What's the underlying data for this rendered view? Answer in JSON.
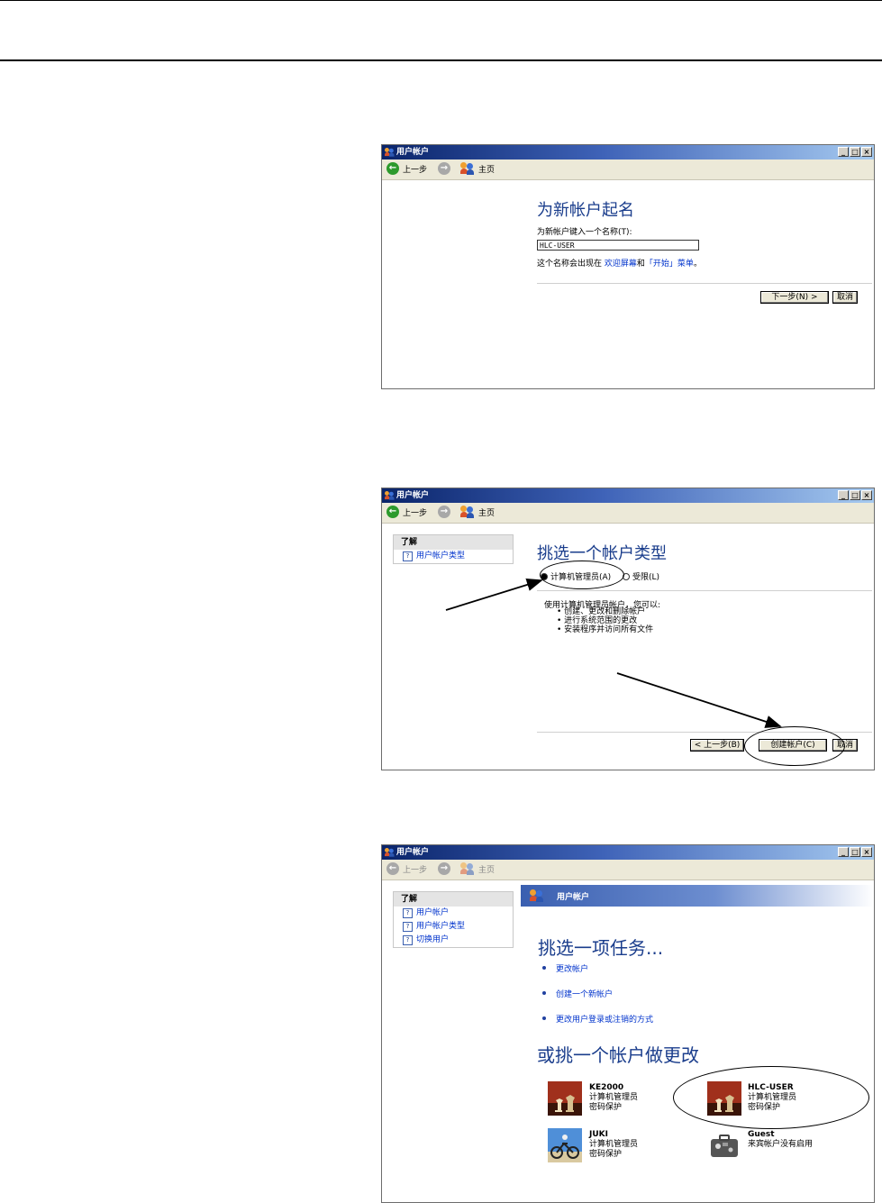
{
  "windows": [
    {
      "title": "用户帐户",
      "toolbar": {
        "back": "上一步",
        "home": "主页"
      },
      "heading": "为新帐户起名",
      "prompt": "为新帐户键入一个名称(T):",
      "name_value": "HLC-USER",
      "note_prefix": "这个名称会出现在",
      "note_link1": "欢迎屏幕",
      "note_and": "和",
      "note_link2": "「开始」菜单",
      "note_suffix": "。",
      "next_button": "下一步(N) >",
      "cancel_button": "取消"
    },
    {
      "title": "用户帐户",
      "toolbar": {
        "back": "上一步",
        "home": "主页"
      },
      "panel_title": "了解",
      "panel_items": [
        "用户帐户类型"
      ],
      "heading": "挑选一个帐户类型",
      "radio_admin": "计算机管理员(A)",
      "radio_limited": "受限(L)",
      "desc_intro": "使用计算机管理员帐户，您可以:",
      "desc_items": [
        "创建、更改和删除帐户",
        "进行系统范围的更改",
        "安装程序并访问所有文件"
      ],
      "back_button": "< 上一步(B)",
      "create_button": "创建帐户(C)",
      "cancel_button": "取消"
    },
    {
      "title": "用户帐户",
      "toolbar": {
        "back": "上一步",
        "home": "主页"
      },
      "panel_title": "了解",
      "panel_items": [
        "用户帐户",
        "用户帐户类型",
        "切换用户"
      ],
      "banner": "用户帐户",
      "heading": "挑选一项任务...",
      "tasks": [
        "更改帐户",
        "创建一个新帐户",
        "更改用户登录或注销的方式"
      ],
      "heading2": "或挑一个帐户做更改",
      "accounts": [
        {
          "name": "KE2000",
          "type": "计算机管理员",
          "status": "密码保护",
          "icon": "chess-icon"
        },
        {
          "name": "HLC-USER",
          "type": "计算机管理员",
          "status": "密码保护",
          "icon": "chess-icon"
        },
        {
          "name": "JUKI",
          "type": "计算机管理员",
          "status": "密码保护",
          "icon": "motorbike-icon"
        },
        {
          "name": "Guest",
          "type": "来宾帐户没有启用",
          "status": "",
          "icon": "suitcase-icon"
        }
      ]
    }
  ],
  "colors": {
    "title_bar": "#0a246a",
    "heading": "#1a3d8c",
    "link": "#0033cc"
  }
}
